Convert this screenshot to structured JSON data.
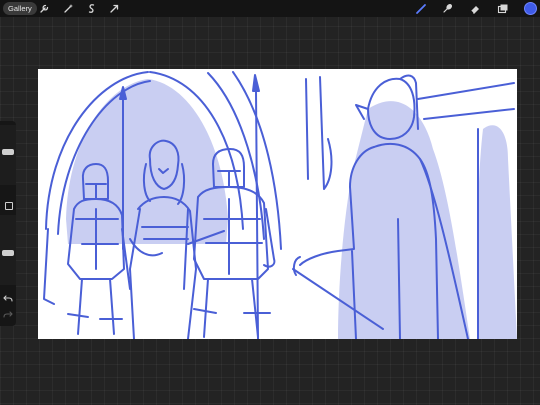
{
  "topbar": {
    "gallery_label": "Gallery",
    "left_tools": [
      {
        "name": "wrench-icon"
      },
      {
        "name": "magic-wand-icon"
      },
      {
        "name": "selection-icon"
      },
      {
        "name": "transform-arrow-icon"
      }
    ],
    "right_tools": [
      {
        "name": "brush-icon",
        "active": true
      },
      {
        "name": "smudge-icon",
        "active": false
      },
      {
        "name": "eraser-icon",
        "active": false
      },
      {
        "name": "layers-icon",
        "active": false
      }
    ],
    "current_color": "#3f5be8"
  },
  "sidebar": {
    "brush_size_level": 0.55,
    "brush_opacity_level": 0.45,
    "icons": [
      "square-modify-icon",
      "undo-icon",
      "redo-icon"
    ]
  },
  "canvas": {
    "ink_color": "#4a5fd6",
    "fill_color": "#c9cef2",
    "background": "#ffffff"
  },
  "colors": {
    "app_background": "#232323",
    "toolbar": "#141414",
    "accent_active": "#5b7cff"
  }
}
